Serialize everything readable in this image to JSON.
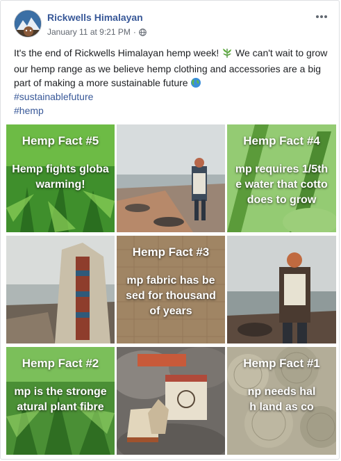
{
  "post": {
    "page_name": "Rickwells Himalayan",
    "timestamp": "January 11 at 9:21 PM",
    "separator": "·",
    "more_icon": "ellipsis-icon",
    "privacy_icon": "globe-icon",
    "text_part1": "It's the end of Rickwells Himalayan hemp week! ",
    "text_part2": " We can't wait to grow our hemp range as we believe hemp clothing and accessories are a big part of making a more sustainable future ",
    "text_icons": [
      "herb-icon",
      "earth-icon"
    ],
    "hashtags": [
      "#sustainablefuture",
      "#hemp"
    ]
  },
  "photos": [
    {
      "kind": "fact",
      "title": "Hemp Fact #5",
      "lines": [
        "Hemp fights globa",
        "warming!"
      ],
      "image": "cannabis-leaves"
    },
    {
      "kind": "photo",
      "image": "person-with-backpack-on-beach"
    },
    {
      "kind": "fact",
      "title": "Hemp Fact #4",
      "lines": [
        "mp requires 1/5th",
        "e water that cotto",
        "does to grow"
      ],
      "image": "plant-closeup"
    },
    {
      "kind": "photo",
      "image": "hemp-backpack-on-shore"
    },
    {
      "kind": "fact",
      "title": "Hemp Fact #3",
      "lines": [
        "mp fabric has be",
        "sed for thousand",
        "of years"
      ],
      "image": "hemp-fabric"
    },
    {
      "kind": "photo",
      "image": "person-from-behind-at-sea"
    },
    {
      "kind": "fact",
      "title": "Hemp Fact #2",
      "lines": [
        "mp is the stronge",
        "atural plant fibre"
      ],
      "image": "cannabis-leaves"
    },
    {
      "kind": "photo",
      "image": "hemp-shoes-and-bags-on-rocks"
    },
    {
      "kind": "fact",
      "title": "Hemp Fact #1",
      "lines": [
        "np needs hal",
        "h land as co"
      ],
      "image": "hemp-yarn-spools"
    }
  ],
  "colors": {
    "link": "#385898",
    "text": "#1c1e21",
    "meta": "#616770"
  }
}
